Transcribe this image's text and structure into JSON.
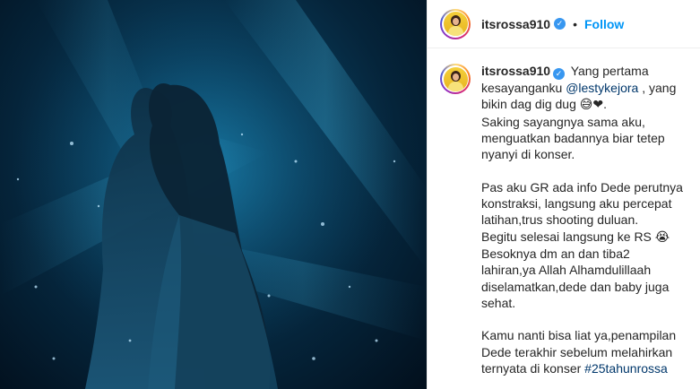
{
  "post": {
    "username": "itsrossa910",
    "header_separator": "•",
    "follow_label": "Follow",
    "verified_icon": "verified-badge-icon",
    "colors": {
      "follow": "#0095f6",
      "link": "#00376b",
      "verified": "#3897f0"
    }
  },
  "caption": {
    "username": "itsrossa910",
    "l1_text": " Yang pertama kesayanganku ",
    "l1_mention": "@lestykejora",
    "l1_text2": " , yang bikin dag dig dug ",
    "l1_emoji": "😅❤",
    "l1_end": ".",
    "l2": "Saking sayangnya sama aku, menguatkan badannya biar tetep nyanyi di konser.",
    "p2_a": "Pas aku GR ada info Dede perutnya konstraksi, langsung aku percepat latihan,trus shooting duluan.",
    "p2_b": "Begitu selesai langsung ke RS ",
    "p2_b_emoji": "😭",
    "p2_c": "Besoknya dm an dan tiba2 lahiran,ya Allah Alhamdulillaah diselamatkan,dede dan baby juga sehat.",
    "p3": "Kamu nanti bisa liat ya,penampilan Dede terakhir sebelum melahirkan ternyata di konser ",
    "p3_hashtag": "#25tahunrossa"
  }
}
